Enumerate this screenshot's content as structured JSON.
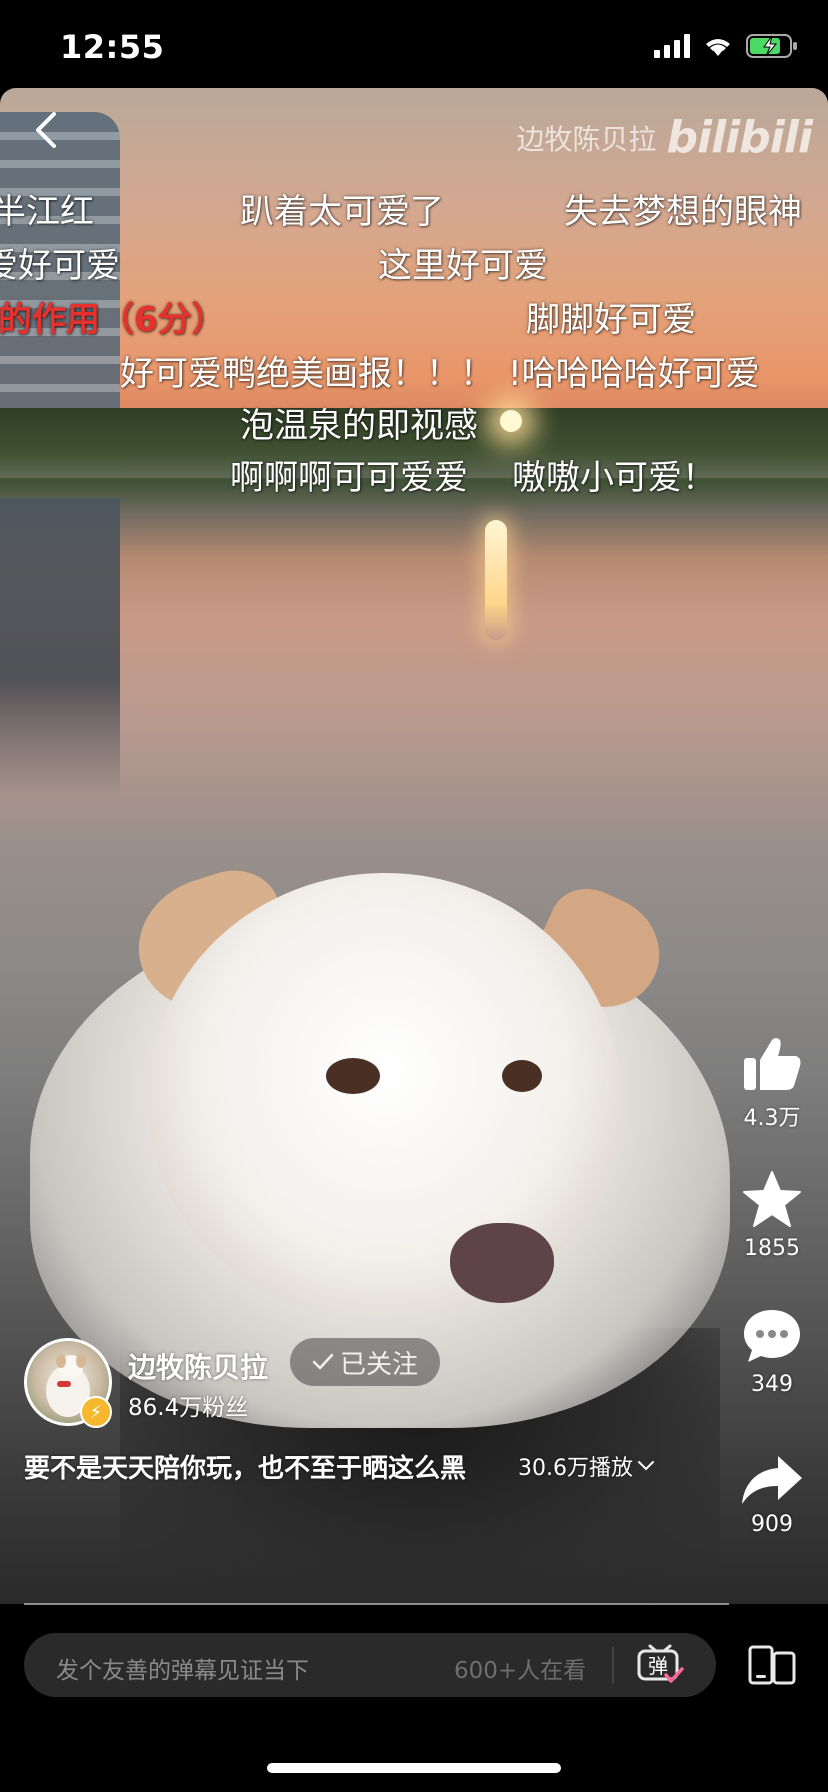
{
  "status_bar": {
    "time": "12:55",
    "icons": [
      "signal-icon",
      "wifi-icon",
      "battery-charging-icon"
    ]
  },
  "video": {
    "watermark_author": "边牧陈贝拉",
    "watermark_logo": "bilibili",
    "danmaku": [
      {
        "text": "半江红",
        "color": "#ffffff"
      },
      {
        "text": "趴着太可爱了",
        "color": "#ffffff"
      },
      {
        "text": "失去梦想的眼神",
        "color": "#ffffff"
      },
      {
        "text": "爱好可爱",
        "color": "#ffffff"
      },
      {
        "text": "这里好可爱",
        "color": "#ffffff"
      },
      {
        "text": "的作用（6分）",
        "color": "#e8302c"
      },
      {
        "text": "脚脚好可爱",
        "color": "#ffffff"
      },
      {
        "text": "好可爱鸭绝美画报！！！",
        "color": "#ffffff"
      },
      {
        "text": "!哈哈哈哈好可爱",
        "color": "#ffffff"
      },
      {
        "text": "泡温泉的即视感",
        "color": "#ffffff"
      },
      {
        "text": "啊啊啊可可爱爱",
        "color": "#ffffff"
      },
      {
        "text": "嗷嗷小可爱！",
        "color": "#ffffff"
      }
    ]
  },
  "actions": {
    "like_count": "4.3万",
    "favorite_count": "1855",
    "comment_count": "349",
    "share_count": "909"
  },
  "author": {
    "name": "边牧陈贝拉",
    "fans": "86.4万粉丝",
    "follow_label": "已关注"
  },
  "caption": {
    "text": "要不是天天陪你玩，也不至于晒这么黑",
    "plays": "30.6万播放"
  },
  "bottom_bar": {
    "comment_placeholder": "发个友善的弹幕见证当下",
    "viewers": "600+人在看",
    "danmaku_toggle_label": "弹"
  },
  "colors": {
    "background": "#000000",
    "danmaku_highlight": "#e8302c",
    "badge": "#f5b82e",
    "battery": "#4cd964"
  }
}
